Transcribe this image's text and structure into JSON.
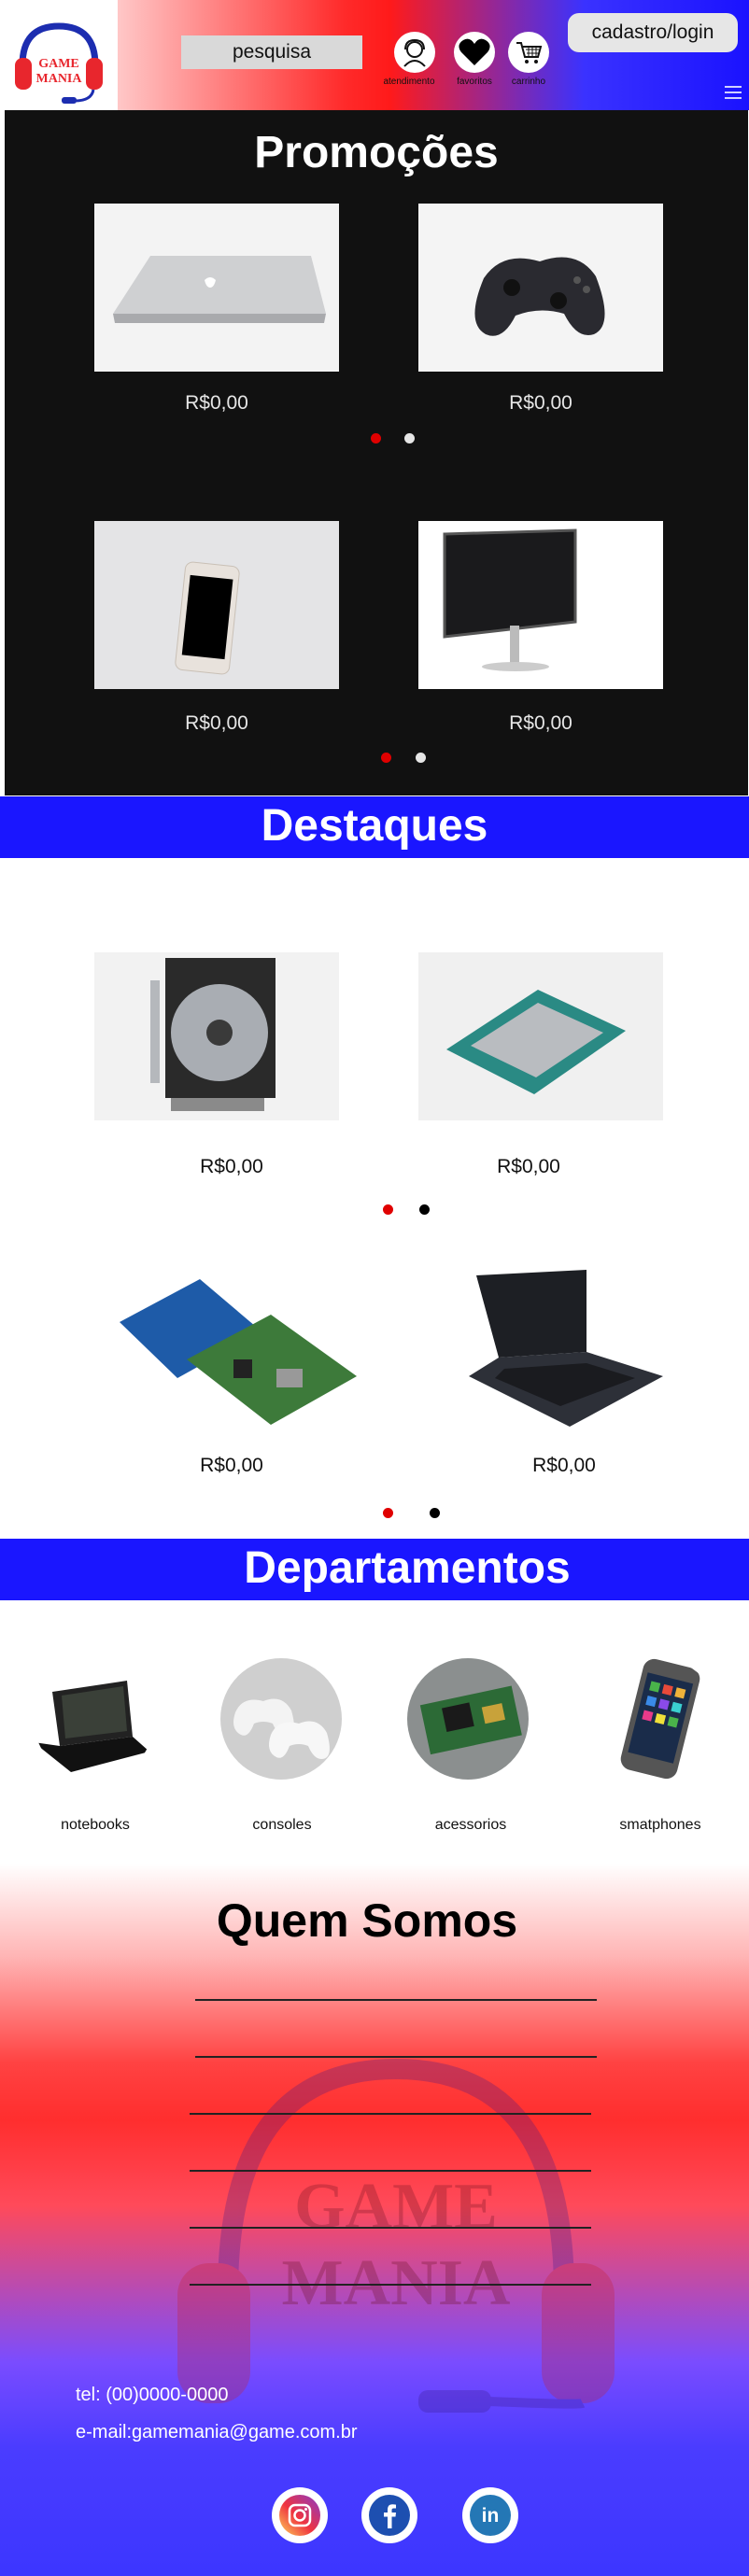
{
  "header": {
    "logo": {
      "line1": "GAME",
      "line2": "MANIA"
    },
    "search_placeholder": "pesquisa",
    "icons": [
      {
        "label": "atendimento",
        "icon": "support-agent-icon"
      },
      {
        "label": "favoritos",
        "icon": "heart-icon"
      },
      {
        "label": "carrinho",
        "icon": "cart-icon"
      }
    ],
    "login_label": "cadastro/login",
    "menu_icon": "hamburger-menu-icon"
  },
  "promocoes": {
    "title": "Promoções",
    "items": [
      {
        "product": "laptop",
        "price": "R$0,00"
      },
      {
        "product": "gamepad",
        "price": "R$0,00"
      },
      {
        "product": "smartphone",
        "price": "R$0,00"
      },
      {
        "product": "monitor",
        "price": "R$0,00"
      }
    ]
  },
  "destaques": {
    "title": "Destaques",
    "items": [
      {
        "product": "cpu-cooler",
        "price": "R$0,00"
      },
      {
        "product": "processor",
        "price": "R$0,00"
      },
      {
        "product": "circuit-boards",
        "price": "R$0,00"
      },
      {
        "product": "laptop",
        "price": "R$0,00"
      }
    ]
  },
  "departamentos": {
    "title": "Departamentos",
    "items": [
      {
        "label": "notebooks"
      },
      {
        "label": "consoles"
      },
      {
        "label": "acessorios"
      },
      {
        "label": "smatphones"
      }
    ]
  },
  "quem_somos": {
    "title": "Quem Somos",
    "watermark": {
      "line1": "GAME",
      "line2": "MANIA"
    },
    "tel": "tel: (00)0000-0000",
    "email": "e-mail:gamemania@game.com.br"
  },
  "social": [
    {
      "icon": "instagram-icon"
    },
    {
      "icon": "facebook-icon"
    },
    {
      "icon": "linkedin-icon"
    }
  ],
  "colors": {
    "brand_red": "#ff1a1a",
    "brand_blue": "#1a16ff",
    "active_dot": "#e00000"
  }
}
